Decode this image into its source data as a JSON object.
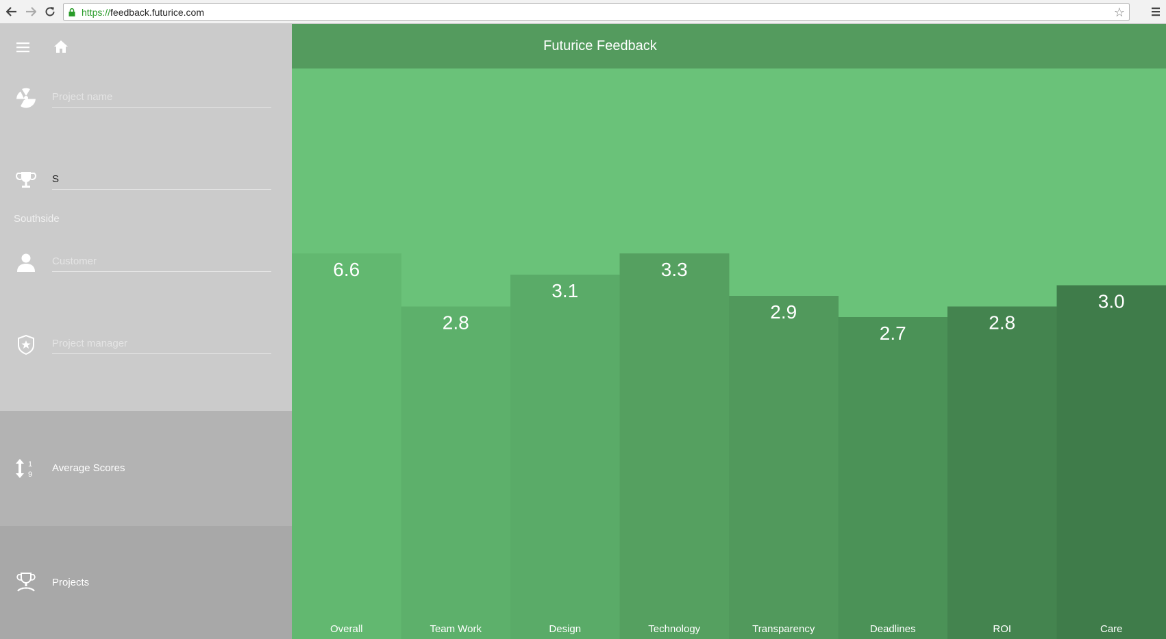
{
  "browser": {
    "url_scheme": "https://",
    "url_host": "feedback.futurice.com"
  },
  "header": {
    "title": "Futurice Feedback"
  },
  "sidebar": {
    "fields": {
      "project_name": {
        "placeholder": "Project name",
        "value": "",
        "icon": "radiation-icon"
      },
      "tribe": {
        "placeholder": "",
        "value": "S",
        "icon": "trophy-icon"
      },
      "customer": {
        "placeholder": "Customer",
        "value": "",
        "icon": "person-icon"
      },
      "project_manager": {
        "placeholder": "Project manager",
        "value": "",
        "icon": "badge-icon"
      }
    },
    "suggestion": "Southside",
    "items": [
      {
        "label": "Average Scores",
        "icon": "sort-numeric-icon"
      },
      {
        "label": "Projects",
        "icon": "trophy-stand-icon"
      }
    ]
  },
  "colors": {
    "background": "#6ac279",
    "header": "#549b5e",
    "sidebar": "#cbcbcb",
    "bars": [
      "#62b870",
      "#5db06b",
      "#5aab68",
      "#55a060",
      "#51995c",
      "#4b9257",
      "#44844f",
      "#3f7c4a"
    ]
  },
  "chart_data": {
    "type": "bar",
    "categories": [
      "Overall",
      "Team Work",
      "Design",
      "Technology",
      "Transparency",
      "Deadlines",
      "ROI",
      "Care"
    ],
    "values": [
      6.6,
      2.8,
      3.1,
      3.3,
      2.9,
      2.7,
      2.8,
      3.0
    ],
    "value_labels": [
      "6.6",
      "2.8",
      "3.1",
      "3.3",
      "2.9",
      "2.7",
      "2.8",
      "3.0"
    ]
  }
}
